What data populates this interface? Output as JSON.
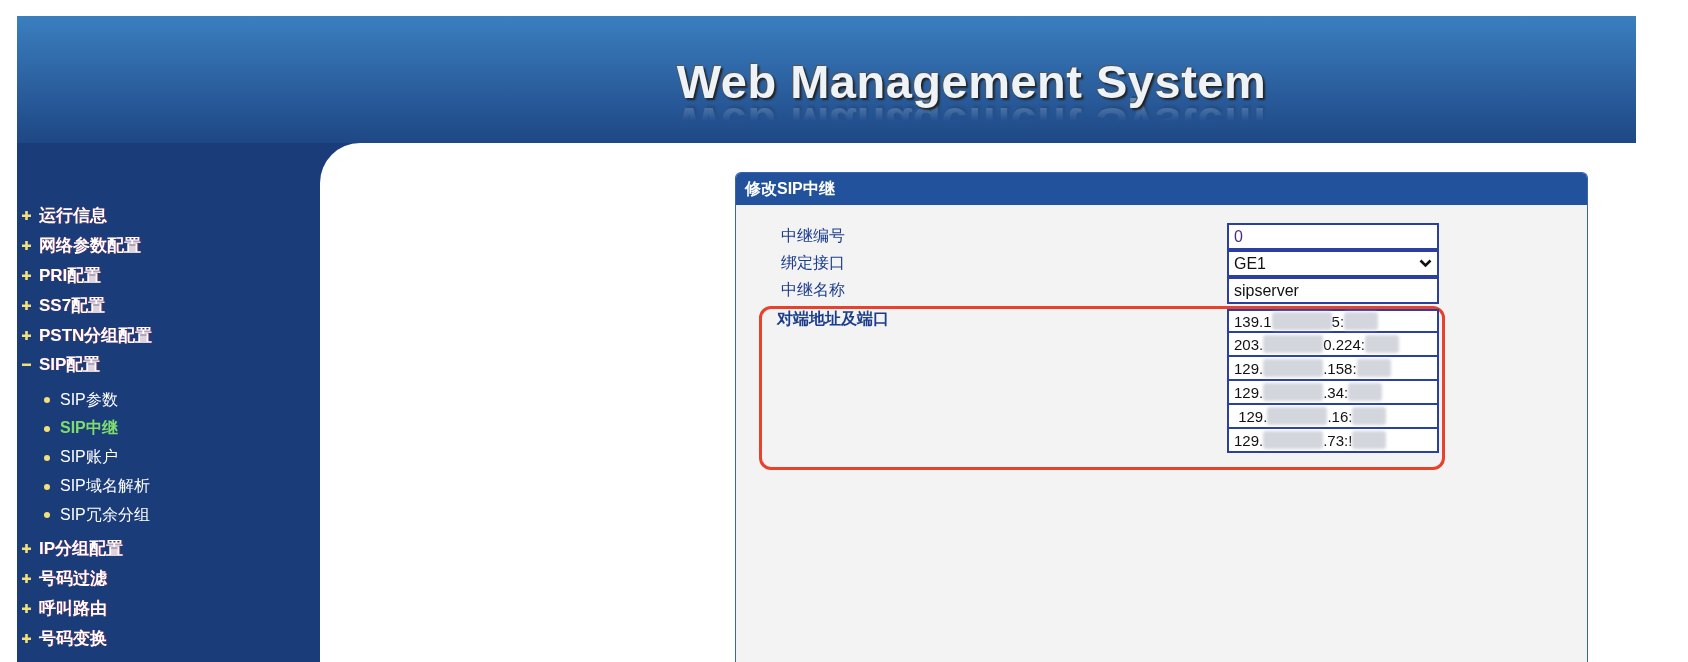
{
  "header": {
    "title": "Web Management System"
  },
  "sidebar": {
    "items": [
      {
        "label": "运行信息",
        "expanded": false
      },
      {
        "label": "网络参数配置",
        "expanded": false
      },
      {
        "label": "PRI配置",
        "expanded": false
      },
      {
        "label": "SS7配置",
        "expanded": false
      },
      {
        "label": "PSTN分组配置",
        "expanded": false
      },
      {
        "label": "SIP配置",
        "expanded": true,
        "children": [
          {
            "label": "SIP参数",
            "selected": false
          },
          {
            "label": "SIP中继",
            "selected": true
          },
          {
            "label": "SIP账户",
            "selected": false
          },
          {
            "label": "SIP域名解析",
            "selected": false
          },
          {
            "label": "SIP冗余分组",
            "selected": false
          }
        ]
      },
      {
        "label": "IP分组配置",
        "expanded": false
      },
      {
        "label": "号码过滤",
        "expanded": false
      },
      {
        "label": "呼叫路由",
        "expanded": false
      },
      {
        "label": "号码变换",
        "expanded": false
      }
    ]
  },
  "panel": {
    "title": "修改SIP中继",
    "fields": [
      {
        "kind": "text",
        "label": "中继编号",
        "value": "0"
      },
      {
        "kind": "select",
        "label": "绑定接口",
        "value": "GE1"
      },
      {
        "kind": "text",
        "label": "中继名称",
        "value": "sipserver"
      },
      {
        "kind": "addresses",
        "label": "对端地址及端口",
        "highlighted": true,
        "addresses": [
          {
            "before": "139.1",
            "after": "5:"
          },
          {
            "before": "203.",
            "after": "0.224:"
          },
          {
            "before": "129.",
            "after": ".158:"
          },
          {
            "before": "129.",
            "after": ".34:"
          },
          {
            "before": " 129.",
            "after": ".16:"
          },
          {
            "before": "129.",
            "after": ".73:!"
          }
        ]
      }
    ]
  }
}
